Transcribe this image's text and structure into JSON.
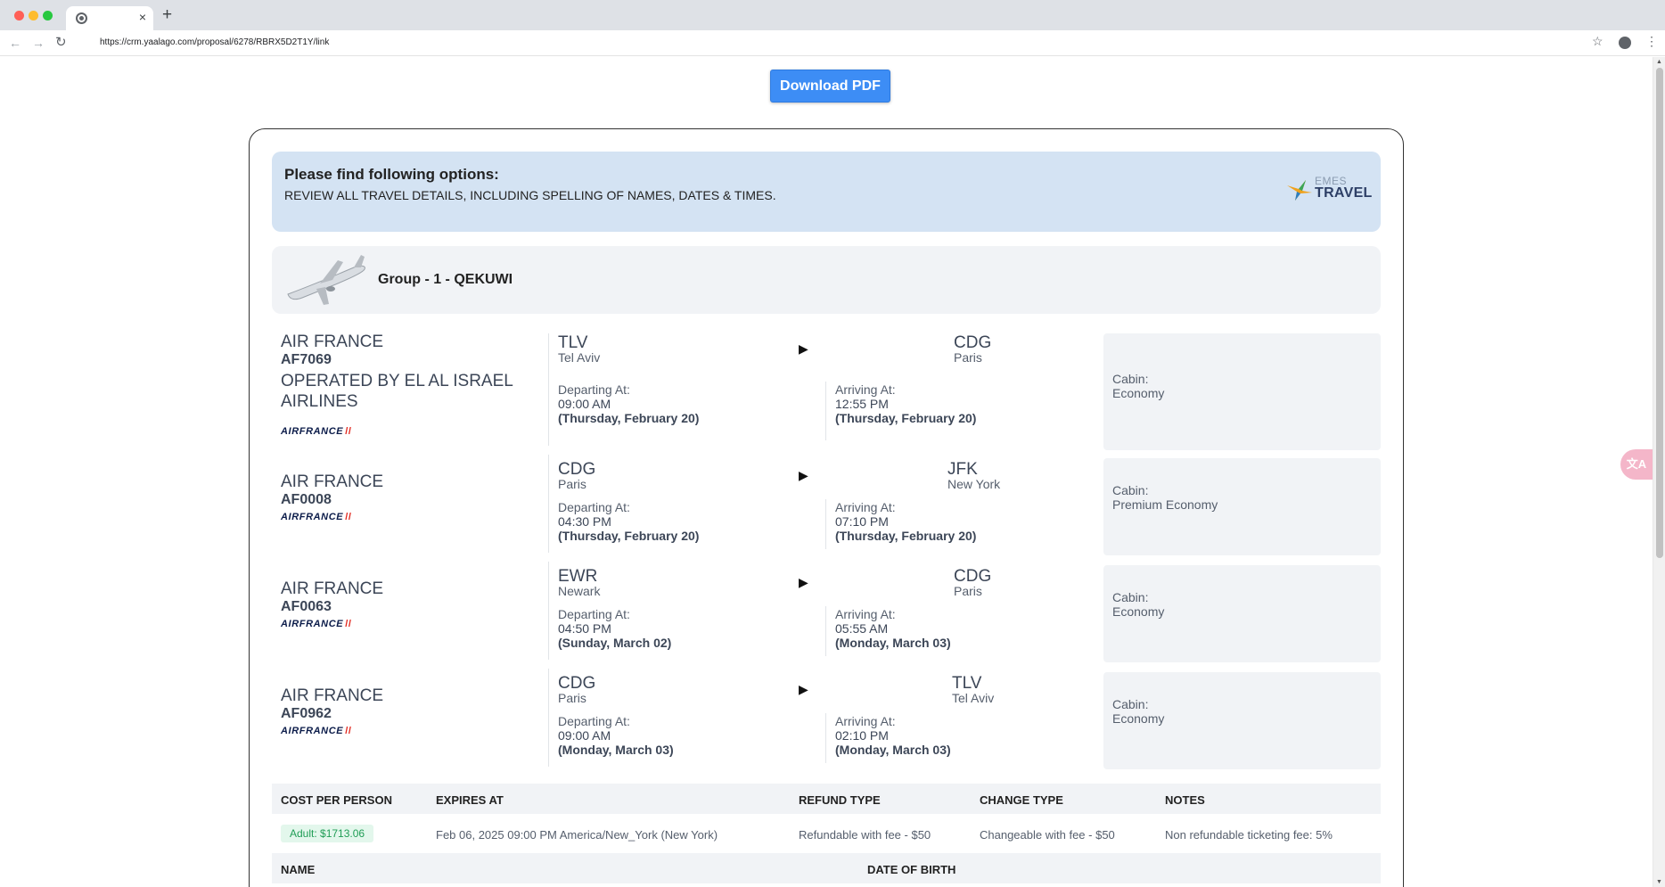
{
  "browser": {
    "tab_close": "×",
    "new_tab": "+",
    "url": "https://crm.yaalago.com/proposal/6278/RBRX5D2T1Y/link",
    "icons": [
      "back-icon",
      "forward-icon",
      "reload-icon",
      "star-icon",
      "profile-icon",
      "menu-icon"
    ]
  },
  "page": {
    "download_label": "Download PDF",
    "banner": {
      "title": "Please find following options:",
      "subtitle": "REVIEW ALL TRAVEL DETAILS, INCLUDING SPELLING OF NAMES, DATES & TIMES.",
      "logo_top": "EMES",
      "logo_bottom": "TRAVEL"
    },
    "group_title": "Group - 1 - QEKUWI",
    "flights": [
      {
        "airline": "AIR FRANCE",
        "flight_no": "AF7069",
        "operated_by": "OPERATED BY EL AL ISRAEL AIRLINES",
        "logo_text": "AIRFRANCE",
        "from_code": "TLV",
        "from_city": "Tel Aviv",
        "to_code": "CDG",
        "to_city": "Paris",
        "depart_label": "Departing At:",
        "depart_time": "09:00 AM",
        "depart_date": "(Thursday, February 20)",
        "arrive_label": "Arriving At:",
        "arrive_time": "12:55 PM",
        "arrive_date": "(Thursday, February 20)",
        "cabin_label": "Cabin:",
        "cabin": "Economy"
      },
      {
        "airline": "AIR FRANCE",
        "flight_no": "AF0008",
        "logo_text": "AIRFRANCE",
        "from_code": "CDG",
        "from_city": "Paris",
        "to_code": "JFK",
        "to_city": "New York",
        "depart_label": "Departing At:",
        "depart_time": "04:30 PM",
        "depart_date": "(Thursday, February 20)",
        "arrive_label": "Arriving At:",
        "arrive_time": "07:10 PM",
        "arrive_date": "(Thursday, February 20)",
        "cabin_label": "Cabin:",
        "cabin": "Premium Economy"
      },
      {
        "airline": "AIR FRANCE",
        "flight_no": "AF0063",
        "logo_text": "AIRFRANCE",
        "from_code": "EWR",
        "from_city": "Newark",
        "to_code": "CDG",
        "to_city": "Paris",
        "depart_label": "Departing At:",
        "depart_time": "04:50 PM",
        "depart_date": "(Sunday, March 02)",
        "arrive_label": "Arriving At:",
        "arrive_time": "05:55 AM",
        "arrive_date": "(Monday, March 03)",
        "cabin_label": "Cabin:",
        "cabin": "Economy"
      },
      {
        "airline": "AIR FRANCE",
        "flight_no": "AF0962",
        "logo_text": "AIRFRANCE",
        "from_code": "CDG",
        "from_city": "Paris",
        "to_code": "TLV",
        "to_city": "Tel Aviv",
        "depart_label": "Departing At:",
        "depart_time": "09:00 AM",
        "depart_date": "(Monday, March 03)",
        "arrive_label": "Arriving At:",
        "arrive_time": "02:10 PM",
        "arrive_date": "(Monday, March 03)",
        "cabin_label": "Cabin:",
        "cabin": "Economy"
      }
    ],
    "arrow_glyph": "▶",
    "cost_table": {
      "headers": [
        "COST PER PERSON",
        "EXPIRES AT",
        "REFUND TYPE",
        "CHANGE TYPE",
        "NOTES"
      ],
      "row": {
        "price": "Adult: $1713.06",
        "expires": "Feb 06, 2025 09:00 PM America/New_York (New York)",
        "refund": "Refundable with fee - $50",
        "change": "Changeable with fee - $50",
        "notes": "Non refundable ticketing fee: 5%"
      }
    },
    "names_table": {
      "headers": [
        "NAME",
        "DATE OF BIRTH"
      ]
    },
    "translate_label": "文A"
  },
  "colors": {
    "accent": "#3d8df5",
    "banner_bg": "#d4e3f3",
    "panel_bg": "#f1f3f6",
    "price_green": "#1f9d55",
    "af_red": "#e1261c",
    "af_navy": "#0c1c4a"
  }
}
